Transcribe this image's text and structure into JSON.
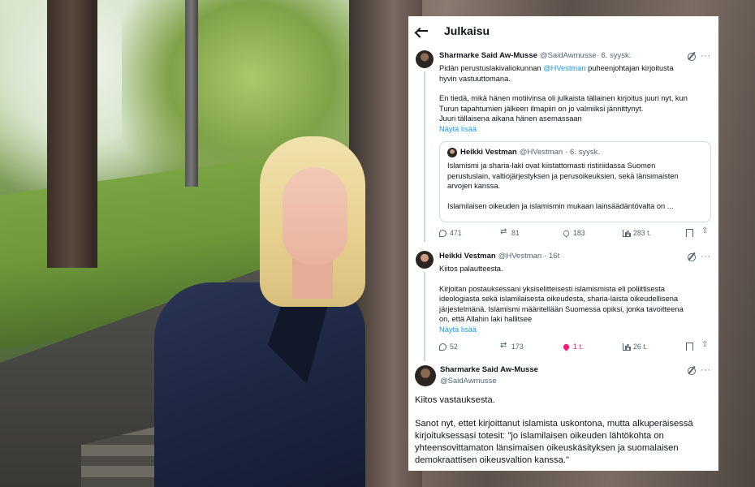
{
  "header": {
    "title": "Julkaisu"
  },
  "post1": {
    "name": "Sharmarke Said Aw-Musse",
    "handle": "@SaidAwmusse",
    "date": "· 6. syysk.",
    "line1": "Pidän perustuslakivaliokunnan ",
    "mention": "@HVestman",
    "line1b": " puheenjohtajan kirjoitusta",
    "line2": "hyvin vastuuttomana.",
    "line3": "En tiedä, mikä hänen motiivinsa oli julkaista tällainen kirjoitus juuri nyt, kun",
    "line4": "Turun tapahtumien jälkeen ilmapiiri on jo valmiiksi jännittynyt.",
    "line5": "Juuri tällaisena aikana hänen asemassaan",
    "show_more": "Näytä lisää"
  },
  "quote": {
    "name": "Heikki Vestman",
    "handle": "@HVestman",
    "date": "· 6. syysk.",
    "line1": "Islamismi ja sharia-laki ovat kiistattomasti ristiriidassa Suomen",
    "line2": "perustuslain, valtiojärjestyksen ja perusoikeuksien, sekä länsimaisten",
    "line3": "arvojen kanssa.",
    "line4": "Islamilaisen oikeuden ja islamismin mukaan lainsäädäntövalta on ..."
  },
  "actions1": {
    "replies": "471",
    "reposts": "81",
    "likes": "183",
    "views": "283 t."
  },
  "post2": {
    "name": "Heikki Vestman",
    "handle": "@HVestman",
    "date": "· 16t",
    "line1": "Kiitos palautteesta.",
    "line2": "Kirjoitan postauksessani yksiselitteisesti islamismista eli poliittisesta",
    "line3": "ideologiasta sekä islamilaisesta oikeudesta, sharia-laista oikeudellisena",
    "line4": "järjestelmänä. Islamismi määritellään Suomessa opiksi, jonka tavoitteena",
    "line5": "on, että Allahin laki hallitsee",
    "show_more": "Näytä lisää"
  },
  "actions2": {
    "replies": "52",
    "reposts": "173",
    "likes": "1 t.",
    "views": "26 t."
  },
  "post3": {
    "name": "Sharmarke Said Aw-Musse",
    "handle": "@SaidAwmusse",
    "line1": "Kiitos vastauksesta.",
    "line2": "Sanot nyt, ettet kirjoittanut islamista uskontona, mutta alkuperäisessä",
    "line3": "kirjoituksessasi totesit: \"jo islamilaisen oikeuden lähtökohta on",
    "line4": "yhteensovittamaton länsimaisen oikeuskäsityksen ja suomalaisen",
    "line5": "demokraattisen oikeusvaltion kanssa.\""
  },
  "colors": {
    "link": "#1d9bf0",
    "like_active": "#f91880",
    "muted": "#536471"
  }
}
